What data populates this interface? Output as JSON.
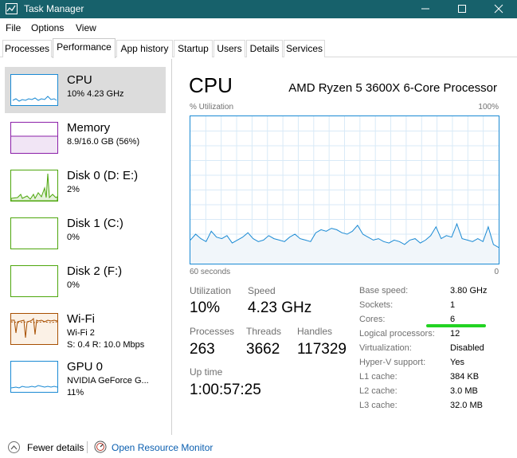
{
  "window": {
    "title": "Task Manager"
  },
  "menu": [
    "File",
    "Options",
    "View"
  ],
  "tabs": [
    "Processes",
    "Performance",
    "App history",
    "Startup",
    "Users",
    "Details",
    "Services"
  ],
  "active_tab": "Performance",
  "sidebar": [
    {
      "name": "CPU",
      "sub1": "10%  4.23 GHz",
      "sub2": "",
      "color": "#1a8ad4"
    },
    {
      "name": "Memory",
      "sub1": "8.9/16.0 GB (56%)",
      "sub2": "",
      "color": "#8b1fa8"
    },
    {
      "name": "Disk 0 (D: E:)",
      "sub1": "2%",
      "sub2": "",
      "color": "#4da60c"
    },
    {
      "name": "Disk 1 (C:)",
      "sub1": "0%",
      "sub2": "",
      "color": "#4da60c"
    },
    {
      "name": "Disk 2 (F:)",
      "sub1": "0%",
      "sub2": "",
      "color": "#4da60c"
    },
    {
      "name": "Wi-Fi",
      "sub1": "Wi-Fi 2",
      "sub2": "S: 0.4  R: 10.0 Mbps",
      "color": "#a74f01"
    },
    {
      "name": "GPU 0",
      "sub1": "NVIDIA GeForce G...",
      "sub2": "11%",
      "color": "#1a8ad4"
    }
  ],
  "main": {
    "title": "CPU",
    "model": "AMD Ryzen 5 3600X 6-Core Processor",
    "graph_label_left": "% Utilization",
    "graph_label_right": "100%",
    "time_left": "60 seconds",
    "time_right": "0",
    "stats": {
      "utilization_label": "Utilization",
      "utilization": "10%",
      "speed_label": "Speed",
      "speed": "4.23 GHz",
      "processes_label": "Processes",
      "processes": "263",
      "threads_label": "Threads",
      "threads": "3662",
      "handles_label": "Handles",
      "handles": "117329",
      "uptime_label": "Up time",
      "uptime": "1:00:57:25"
    },
    "specs": [
      {
        "label": "Base speed:",
        "value": "3.80 GHz"
      },
      {
        "label": "Sockets:",
        "value": "1"
      },
      {
        "label": "Cores:",
        "value": "6"
      },
      {
        "label": "Logical processors:",
        "value": "12"
      },
      {
        "label": "Virtualization:",
        "value": "Disabled"
      },
      {
        "label": "Hyper-V support:",
        "value": "Yes"
      },
      {
        "label": "L1 cache:",
        "value": "384 KB"
      },
      {
        "label": "L2 cache:",
        "value": "3.0 MB"
      },
      {
        "label": "L3 cache:",
        "value": "32.0 MB"
      }
    ]
  },
  "footer": {
    "fewer_details": "Fewer details",
    "open_monitor": "Open Resource Monitor"
  },
  "colors": {
    "titlebar": "#17616b",
    "cpu": "#1a8ad4",
    "memory": "#8b1fa8",
    "disk": "#4da60c",
    "wifi": "#a74f01",
    "annotation": "#22d322",
    "link": "#0b5fb0"
  },
  "cpu_history": [
    16,
    20,
    17,
    15,
    22,
    18,
    17,
    19,
    14,
    16,
    18,
    21,
    17,
    15,
    16,
    19,
    17,
    16,
    15,
    18,
    20,
    17,
    16,
    15,
    21,
    23,
    22,
    24,
    23,
    21,
    20,
    22,
    26,
    20,
    18,
    16,
    17,
    15,
    14,
    16,
    15,
    13,
    16,
    17,
    14,
    16,
    19,
    25,
    17,
    19,
    18,
    27,
    17,
    16,
    15,
    17,
    15,
    25,
    13,
    11
  ],
  "chart_data": {
    "type": "area",
    "title": "CPU",
    "xlabel": "60 seconds",
    "ylabel": "% Utilization",
    "ylim": [
      0,
      100
    ],
    "series": [
      {
        "values": [
          16,
          20,
          17,
          15,
          22,
          18,
          17,
          19,
          14,
          16,
          18,
          21,
          17,
          15,
          16,
          19,
          17,
          16,
          15,
          18,
          20,
          17,
          16,
          15,
          21,
          23,
          22,
          24,
          23,
          21,
          20,
          22,
          26,
          20,
          18,
          16,
          17,
          15,
          14,
          16,
          15,
          13,
          16,
          17,
          14,
          16,
          19,
          25,
          17,
          19,
          18,
          27,
          17,
          16,
          15,
          17,
          15,
          25,
          13,
          11
        ]
      }
    ]
  }
}
